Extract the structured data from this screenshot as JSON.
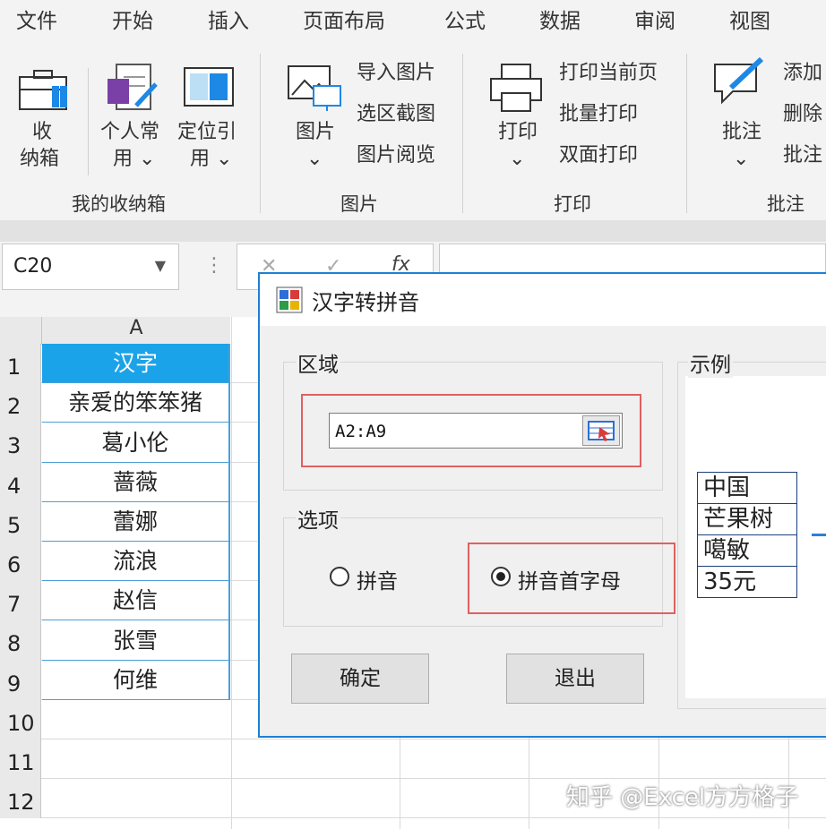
{
  "ribbon_tabs": [
    "文件",
    "开始",
    "插入",
    "页面布局",
    "公式",
    "数据",
    "审阅",
    "视图"
  ],
  "ribbon": {
    "storage": {
      "box_label_1": "收",
      "box_label_2": "纳箱",
      "personal_1": "个人常",
      "personal_2": "用",
      "locate_1": "定位引",
      "locate_2": "用",
      "group": "我的收纳箱"
    },
    "picture": {
      "big_1": "图片",
      "import": "导入图片",
      "snip": "选区截图",
      "browse": "图片阅览",
      "group": "图片"
    },
    "print": {
      "big_1": "打印",
      "current": "打印当前页",
      "batch": "批量打印",
      "duplex": "双面打印",
      "group": "打印"
    },
    "comment": {
      "big_1": "批注",
      "add": "添加",
      "delete": "删除",
      "small3": "批注",
      "group": "批注"
    },
    "dropdown_glyph": "⌄"
  },
  "formula_bar": {
    "name_box": "C20",
    "cancel": "✕",
    "enter": "✓",
    "fx": "fx",
    "dots": "⋮"
  },
  "sheet": {
    "column": "A",
    "rows": [
      "1",
      "2",
      "3",
      "4",
      "5",
      "6",
      "7",
      "8",
      "9",
      "10",
      "11",
      "12"
    ],
    "cells": [
      "汉字",
      "亲爱的笨笨猪",
      "葛小伦",
      "蔷薇",
      "蕾娜",
      "流浪",
      "赵信",
      "张雪",
      "何维"
    ]
  },
  "dialog": {
    "title": "汉字转拼音",
    "range_legend": "区域",
    "range_value": "A2:A9",
    "options_legend": "选项",
    "opt_pinyin": "拼音",
    "opt_initials": "拼音首字母",
    "selected": "拼音首字母",
    "ok": "确定",
    "exit": "退出",
    "example_legend": "示例",
    "example_rows": [
      "中国",
      "芒果树",
      "噶敏",
      "35元"
    ]
  },
  "watermark": "知乎 @Excel方方格子",
  "colors": {
    "accent": "#1e7fd6",
    "header_fill": "#1aa3e8",
    "highlight": "#e06060"
  }
}
